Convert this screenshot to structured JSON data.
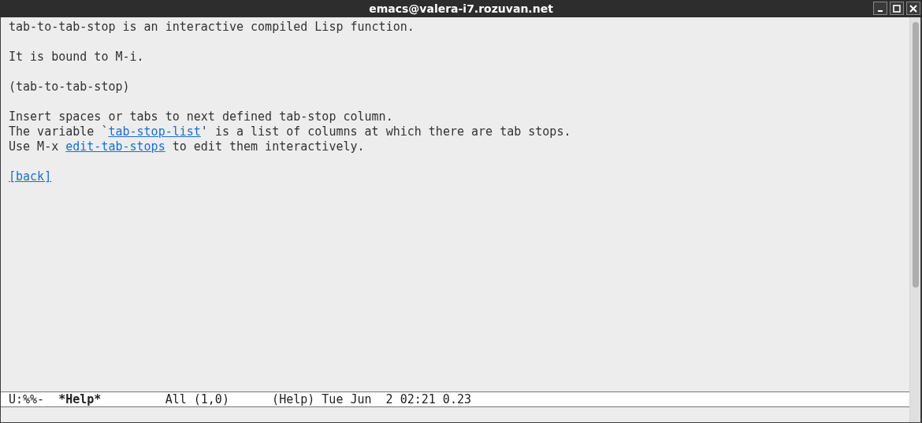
{
  "window": {
    "title": "emacs@valera-i7.rozuvan.net"
  },
  "paragraphs": [
    [
      [
        {
          "kind": "text",
          "text": "tab-to-tab-stop is an interactive compiled Lisp function."
        }
      ]
    ],
    [
      [
        {
          "kind": "text",
          "text": "It is bound to M-i."
        }
      ]
    ],
    [
      [
        {
          "kind": "text",
          "text": "(tab-to-tab-stop)"
        }
      ]
    ],
    [
      [
        {
          "kind": "text",
          "text": "Insert spaces or tabs to next defined tab-stop column."
        }
      ],
      [
        {
          "kind": "text",
          "text": "The variable `"
        },
        {
          "kind": "link",
          "text": "tab-stop-list"
        },
        {
          "kind": "text",
          "text": "' is a list of columns at which there are tab stops."
        }
      ],
      [
        {
          "kind": "text",
          "text": "Use M-x "
        },
        {
          "kind": "link",
          "text": "edit-tab-stops"
        },
        {
          "kind": "text",
          "text": " to edit them interactively."
        }
      ]
    ],
    [
      [
        {
          "kind": "link",
          "text": "[back]"
        }
      ]
    ]
  ],
  "mode_line": {
    "status": "U:%%-",
    "buffer": "*Help*",
    "position": "All (1,0)",
    "info": "(Help) Tue Jun  2 02:21 0.23"
  }
}
